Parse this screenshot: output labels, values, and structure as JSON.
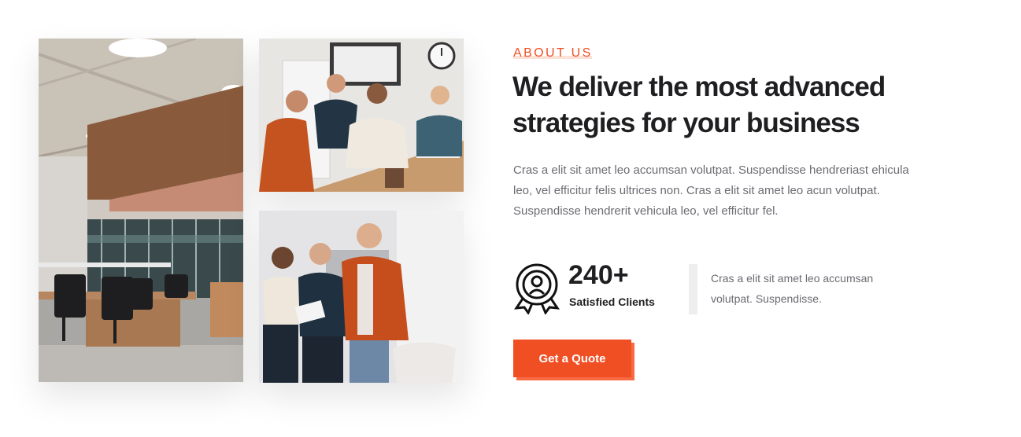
{
  "about": {
    "eyebrow": "ABOUT US",
    "headline_line1": "We deliver the most advanced",
    "headline_line2": "strategies for your business",
    "body": "Cras a elit sit amet leo accumsan volutpat. Suspendisse hendreriast ehicula leo, vel efficitur felis ultrices non. Cras a elit sit amet leo acun volutpat. Suspendisse hendrerit vehicula leo, vel efficitur fel."
  },
  "stat": {
    "icon": "award-ribbon-icon",
    "number": "240+",
    "label": "Satisfied Clients",
    "note": "Cras a elit sit amet leo accumsan volutpat. Suspendisse."
  },
  "cta": {
    "label": "Get a Quote"
  },
  "colors": {
    "accent": "#f04e23",
    "heading": "#1f1f22",
    "body_text": "#6b6b72"
  },
  "images": [
    {
      "name": "office-interior-photo"
    },
    {
      "name": "team-meeting-photo"
    },
    {
      "name": "team-standing-photo"
    }
  ]
}
